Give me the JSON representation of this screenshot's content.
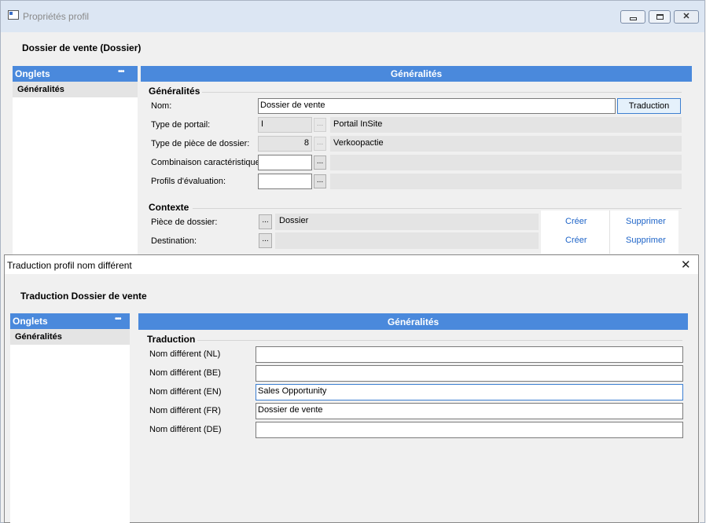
{
  "back_window": {
    "title": "Propriétés profil",
    "heading": "Dossier de vente (Dossier)",
    "tabs_header": "Onglets",
    "tabs_more": "•••",
    "tabs": [
      "Généralités"
    ],
    "section_title": "Généralités",
    "generalites_label": "Généralités",
    "fields": {
      "nom_label": "Nom:",
      "nom_value": "Dossier de vente",
      "translate_button": "Traduction",
      "type_portail_label": "Type de portail:",
      "type_portail_value": "I",
      "type_portail_desc": "Portail InSite",
      "type_piece_label": "Type de pièce de dossier:",
      "type_piece_value": "8",
      "type_piece_desc": "Verkoopactie",
      "combinaison_label": "Combinaison caractéristiques",
      "profils_label": "Profils d'évaluation:",
      "ellipsis": "..."
    },
    "contexte": {
      "label": "Contexte",
      "piece_label": "Pièce de dossier:",
      "piece_value": "Dossier",
      "destination_label": "Destination:",
      "create": "Créer",
      "delete": "Supprimer"
    }
  },
  "front_window": {
    "title": "Traduction profil nom différent",
    "close_symbol": "✕",
    "heading": "Traduction Dossier de vente",
    "tabs_header": "Onglets",
    "tabs_more": "•••",
    "tabs": [
      "Généralités"
    ],
    "section_title": "Généralités",
    "traduction_label": "Traduction",
    "rows": [
      {
        "label": "Nom différent (NL)",
        "value": ""
      },
      {
        "label": "Nom différent (BE)",
        "value": ""
      },
      {
        "label": "Nom différent (EN)",
        "value": "Sales Opportunity"
      },
      {
        "label": "Nom différent (FR)",
        "value": "Dossier de vente"
      },
      {
        "label": "Nom différent (DE)",
        "value": ""
      }
    ]
  },
  "colors": {
    "accent_blue": "#4a89dc",
    "link_blue": "#1e64c8",
    "focus_border": "#3c7fd1"
  }
}
